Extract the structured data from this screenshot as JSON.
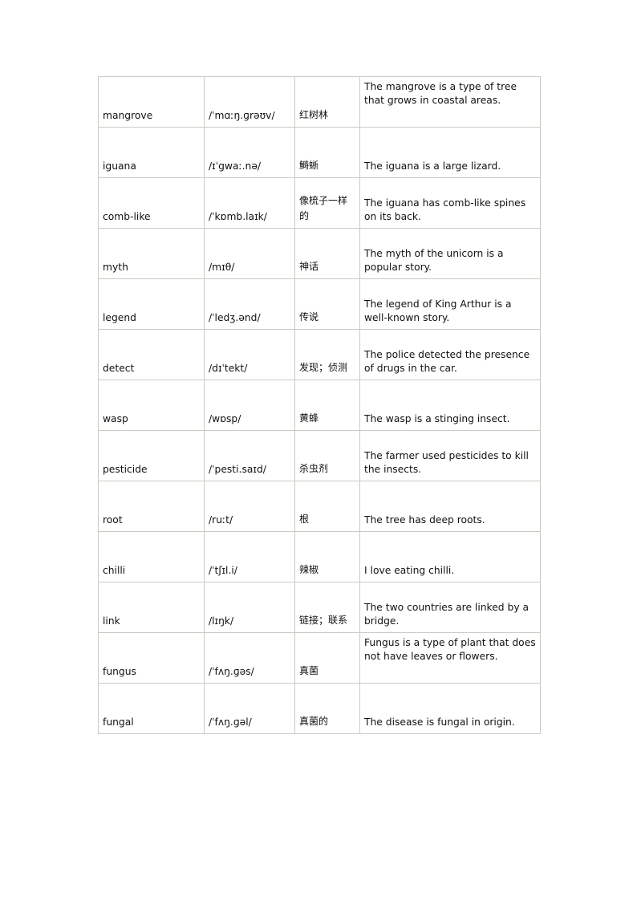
{
  "document": {
    "type": "vocabulary-table",
    "page_background": "#ffffff",
    "border_color": "#cbcbc4",
    "text_color": "#111111",
    "row_count": 13,
    "column_count": 4
  },
  "table": {
    "columns": [
      {
        "key": "word",
        "name": "word-column"
      },
      {
        "key": "ipa",
        "name": "pronunciation-column"
      },
      {
        "key": "zh",
        "name": "chinese-column"
      },
      {
        "key": "sentence",
        "name": "example-sentence-column"
      }
    ],
    "rows": [
      {
        "word": "mangrove",
        "ipa": "/ˈmɑːŋ.ɡrəʊv/",
        "zh": "红树林",
        "sentence": "The mangrove is a type of tree that grows in coastal areas.",
        "sentence_lines": 3
      },
      {
        "word": "iguana",
        "ipa": "/ɪˈgwaː.nə/",
        "zh": "鰣蜥",
        "sentence": "The iguana is a large lizard.",
        "sentence_lines": 1
      },
      {
        "word": "comb-like",
        "ipa": "/ˈkɒmb.laɪk/",
        "zh": "像梳子一样的",
        "sentence": "The iguana has comb-like spines on its back.",
        "sentence_lines": 2
      },
      {
        "word": "myth",
        "ipa": "/mɪθ/",
        "zh": "神话",
        "sentence": "The myth of the unicorn is a popular story.",
        "sentence_lines": 2
      },
      {
        "word": "legend",
        "ipa": "/ˈledʒ.ənd/",
        "zh": "传说",
        "sentence": "The legend of King Arthur is a well-known story.",
        "sentence_lines": 2
      },
      {
        "word": "detect",
        "ipa": "/dɪˈtekt/",
        "zh": "发现；侦测",
        "sentence": "The police detected the presence of drugs in the car.",
        "sentence_lines": 2
      },
      {
        "word": "wasp",
        "ipa": "/wɒsp/",
        "zh": "黄蜂",
        "sentence": "The wasp is a stinging insect.",
        "sentence_lines": 1
      },
      {
        "word": "pesticide",
        "ipa": "/ˈpesti.saɪd/",
        "zh": "杀虫剂",
        "sentence": "The farmer used pesticides to kill the insects.",
        "sentence_lines": 2
      },
      {
        "word": "root",
        "ipa": "/ruːt/",
        "zh": "根",
        "sentence": "The tree has deep roots.",
        "sentence_lines": 1
      },
      {
        "word": "chilli",
        "ipa": "/ˈtʃɪl.i/",
        "zh": "辣椒",
        "sentence": "I love eating chilli.",
        "sentence_lines": 1
      },
      {
        "word": "link",
        "ipa": "/lɪŋk/",
        "zh": "链接；联系",
        "sentence": "The two countries are linked by a bridge.",
        "sentence_lines": 2
      },
      {
        "word": "fungus",
        "ipa": "/ˈfʌŋ.ɡəs/",
        "zh": "真菌",
        "sentence": "Fungus is a type of plant that does not have leaves or flowers.",
        "sentence_lines": 3
      },
      {
        "word": "fungal",
        "ipa": "/ˈfʌŋ.ɡəl/",
        "zh": "真菌的",
        "sentence": "The disease is fungal in origin.",
        "sentence_lines": 1
      }
    ]
  }
}
